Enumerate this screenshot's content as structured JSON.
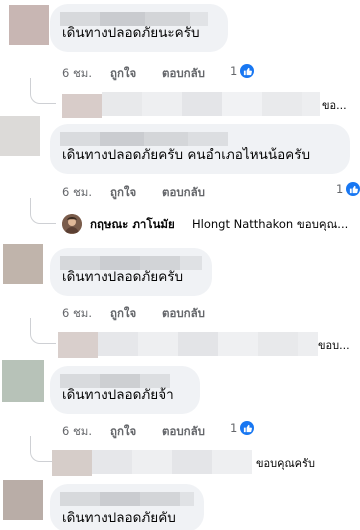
{
  "colors": {
    "bubble": "#f0f2f5",
    "meta": "#65676b",
    "like": "#1877f2",
    "text": "#050505"
  },
  "comments": [
    {
      "text": "เดินทางปลอดภัยนะครับ",
      "time": "6 ชม.",
      "like_label": "ถูกใจ",
      "reply_label": "ตอบกลับ",
      "reaction_count": "1",
      "reaction_icon": "like-icon",
      "reply_preview": "ขอ..."
    },
    {
      "text": "เดินทางปลอดภัยครับ คนอำเภอไหนน้อครับ",
      "time": "6 ชม.",
      "like_label": "ถูกใจ",
      "reply_label": "ตอบกลับ",
      "reaction_count": "1",
      "reaction_icon": "like-icon",
      "reply_author": "กฤษณะ ภาโนมัย",
      "reply_preview": "Hlongt Natthakon ขอบคุณ..."
    },
    {
      "text": "เดินทางปลอดภัยครับ",
      "time": "6 ชม.",
      "like_label": "ถูกใจ",
      "reply_label": "ตอบกลับ",
      "reply_preview": "ขอบ..."
    },
    {
      "text": "เดินทางปลอดภัยจ้า",
      "time": "6 ชม.",
      "like_label": "ถูกใจ",
      "reply_label": "ตอบกลับ",
      "reaction_count": "1",
      "reaction_icon": "like-icon",
      "reply_preview": "ขอบคุณครับ"
    },
    {
      "text": "เดินทางปลอดภัยคับ"
    }
  ]
}
